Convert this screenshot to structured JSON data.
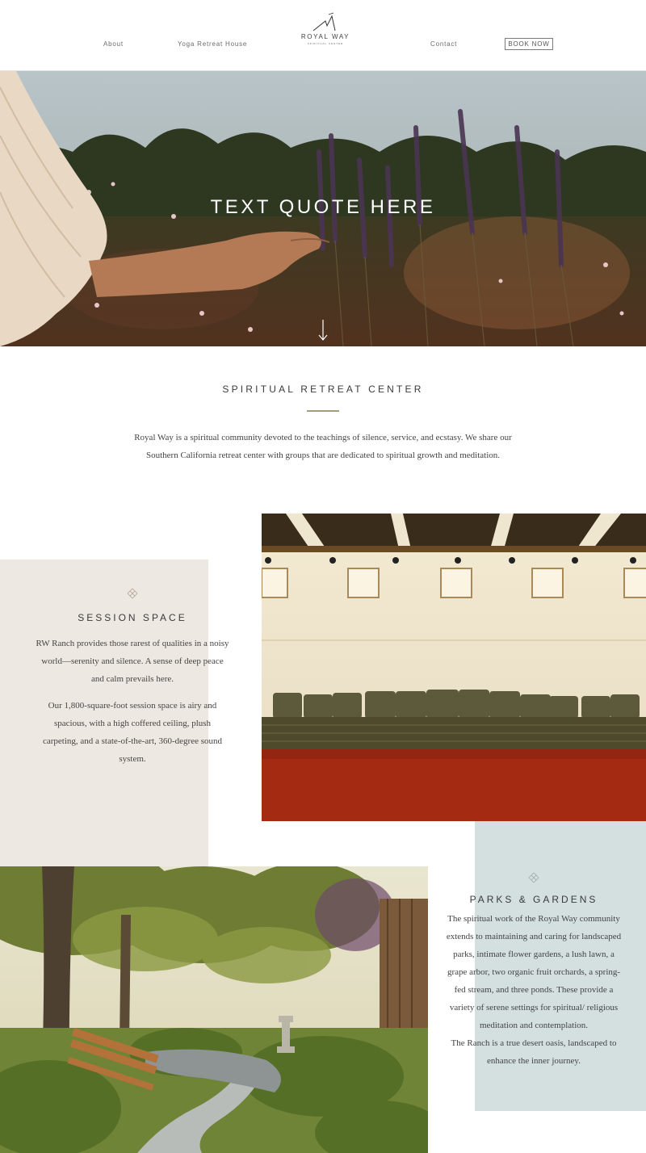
{
  "header": {
    "nav": {
      "about": "About",
      "yoga": "Yoga Retreat House",
      "contact": "Contact"
    },
    "logo": {
      "title": "ROYAL WAY",
      "subtitle": "SPIRITUAL CENTER"
    },
    "book_button": "BOOK NOW"
  },
  "hero": {
    "quote": "TEXT QUOTE HERE",
    "scroll_icon": "down-arrow-icon"
  },
  "intro": {
    "title": "SPIRITUAL RETREAT CENTER",
    "text": "Royal Way is a spiritual community devoted to the teachings of silence, service, and ecstasy. We share our Southern California retreat center with groups that are dedicated to spiritual growth and meditation."
  },
  "session": {
    "icon": "diamond-flower-icon",
    "title": "SESSION SPACE",
    "p1": "RW Ranch provides those rarest of qualities in a noisy world—serenity and silence. A sense of deep peace and calm prevails here.",
    "p2": "Our 1,800-square-foot session space is airy and spacious, with a high coffered ceiling, plush carpeting, and a state-of-the-art, 360-degree sound system."
  },
  "parks": {
    "icon": "diamond-flower-icon",
    "title": "PARKS & GARDENS",
    "p1": "The spiritual work of the Royal Way community extends to maintaining and caring for landscaped parks, intimate flower gardens, a lush lawn, a grape arbor, two organic fruit orchards, a spring-fed stream, and three ponds. These provide a variety of serene settings for spiritual/ religious meditation and contemplation.",
    "p2": "The Ranch is a true desert oasis, landscaped to enhance the inner journey."
  },
  "colors": {
    "session_bg": "#eee8e3",
    "parks_bg": "#d4dfdf",
    "accent_rule": "#a89a7f"
  }
}
